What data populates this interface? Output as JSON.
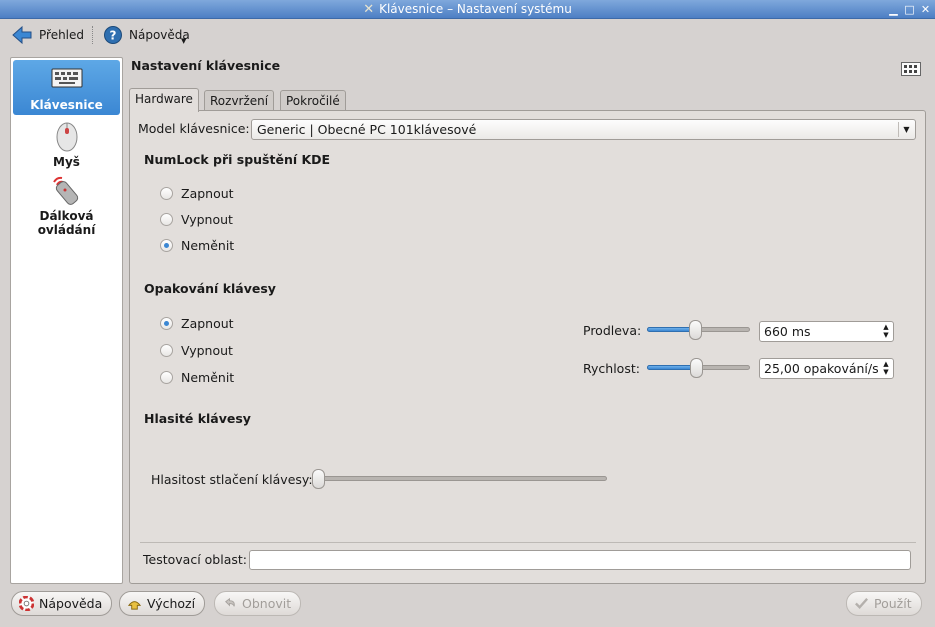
{
  "window": {
    "title": "Klávesnice – Nastavení systému"
  },
  "toolbar": {
    "back_label": "Přehled",
    "help_label": "Nápověda"
  },
  "sidebar": {
    "items": [
      {
        "label": "Klávesnice",
        "icon": "keyboard-icon",
        "active": true
      },
      {
        "label": "Myš",
        "icon": "mouse-icon",
        "active": false
      },
      {
        "label_line1": "Dálková",
        "label_line2": "ovládání",
        "icon": "remote-control-icon",
        "active": false
      }
    ]
  },
  "main": {
    "title": "Nastavení klávesnice",
    "tabs": [
      {
        "label": "Hardware"
      },
      {
        "label": "Rozvržení"
      },
      {
        "label": "Pokročilé"
      }
    ],
    "model": {
      "label": "Model klávesnice:",
      "value": "Generic | Obecné PC 101klávesové"
    },
    "numlock": {
      "heading": "NumLock při spuštění KDE",
      "options": [
        "Zapnout",
        "Vypnout",
        "Neměnit"
      ],
      "selected": "Neměnit"
    },
    "repeat": {
      "heading": "Opakování klávesy",
      "options": [
        "Zapnout",
        "Vypnout",
        "Neměnit"
      ],
      "selected": "Zapnout",
      "delay": {
        "label": "Prodleva:",
        "value": "660 ms",
        "slider_fraction": 0.47
      },
      "rate": {
        "label": "Rychlost:",
        "value": "25,00 opakování/s",
        "slider_fraction": 0.48
      }
    },
    "click": {
      "heading": "Hlasité klávesy",
      "volume_label": "Hlasitost stlačení klávesy:",
      "slider_fraction": 0.0
    },
    "test_area": {
      "label": "Testovací oblast:",
      "value": ""
    }
  },
  "buttons": {
    "help": "Nápověda",
    "defaults": "Výchozí",
    "reset": "Obnovit",
    "apply": "Použít"
  },
  "colors": {
    "accent": "#3b87d3",
    "titlebar": "#5b8ccc",
    "window_bg": "#d6d2d0"
  }
}
